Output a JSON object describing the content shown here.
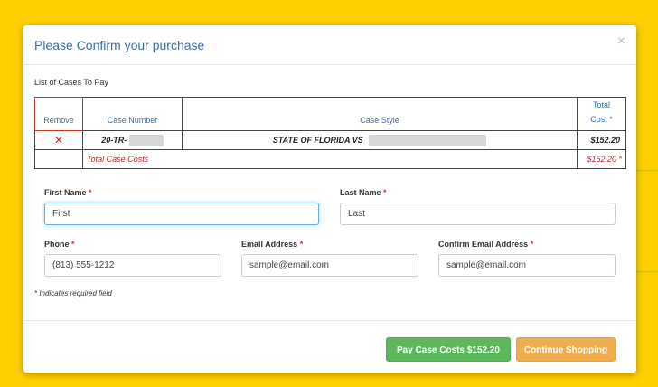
{
  "modal": {
    "title": "Please Confirm your purchase",
    "close_label": "×"
  },
  "cases": {
    "list_title": "List of Cases To Pay",
    "headers": {
      "remove": "Remove",
      "case_number": "Case Number",
      "case_style": "Case Style",
      "total_cost_line1": "Total",
      "total_cost_line2": "Cost *"
    },
    "rows": [
      {
        "remove_icon": "✕",
        "case_number": "20-TR-",
        "case_style": "STATE OF FLORIDA VS",
        "cost": "$152.20"
      }
    ],
    "total_label": "Total Case Costs",
    "total_value": "$152.20 *"
  },
  "form": {
    "required_marker": "*",
    "first_name": {
      "label": "First Name",
      "value": "First"
    },
    "last_name": {
      "label": "Last Name",
      "value": "Last"
    },
    "phone": {
      "label": "Phone",
      "value": "(813) 555-1212"
    },
    "email": {
      "label": "Email Address",
      "value": "sample@email.com"
    },
    "confirm_email": {
      "label": "Confirm Email Address",
      "value": "sample@email.com"
    },
    "required_note": "* Indicates required field"
  },
  "footer": {
    "pay_button": "Pay Case Costs $152.20",
    "continue_button": "Continue Shopping"
  },
  "colors": {
    "backdrop": "#ffd000",
    "title": "#3b6fa8",
    "required": "#c0392b",
    "pay_button": "#5cb85c",
    "continue_button": "#f0ad4e"
  }
}
